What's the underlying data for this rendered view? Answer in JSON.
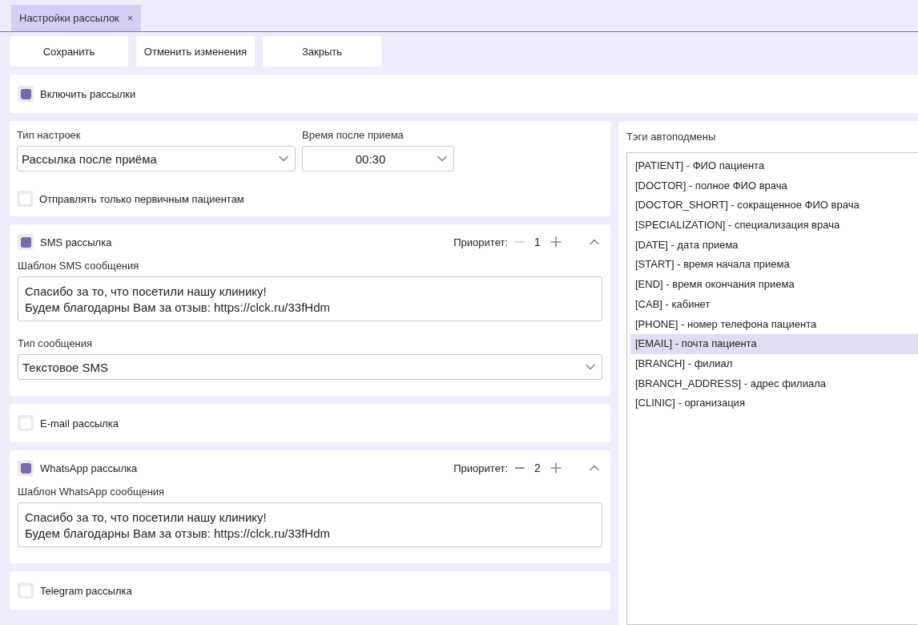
{
  "tabs": [
    {
      "label": "Настройки рассылок",
      "close": "×",
      "selected": true
    }
  ],
  "toolbar": {
    "buttons": [
      "Сохранить",
      "Отменить изменения",
      "Закрыть"
    ]
  },
  "enable_mailings": {
    "label": "Включить рассылки",
    "checked": true
  },
  "settings": {
    "type_label": "Тип настроек",
    "type_value": "Рассылка после приёма",
    "time_label": "Время после приема",
    "time_value": "00:30",
    "first_only": {
      "label": "Отправлять только первичным пациентам",
      "checked": false
    }
  },
  "channels": [
    {
      "label": "SMS рассылка",
      "checked": true,
      "priority_label": "Приоритет:",
      "priority": "1",
      "decrease_disabled": true,
      "expanded": true,
      "template_label": "Шаблон SMS сообщения",
      "template_lines": [
        "Спасибо за то, что посетили нашу клинику!",
        "Будем благодарны Вам за отзыв: https://clck.ru/33fHdm"
      ],
      "message_type_label": "Тип сообщения",
      "message_type": "Текстовое SMS"
    },
    {
      "label": "E-mail рассылка",
      "checked": false
    },
    {
      "label": "WhatsApp рассылка",
      "checked": true,
      "priority_label": "Приоритет:",
      "priority": "2",
      "decrease_disabled": false,
      "expanded": true,
      "template_label": "Шаблон WhatsApp сообщения",
      "template_lines": [
        "Спасибо за то, что посетили нашу клинику!",
        "Будем благодарны Вам за отзыв: https://clck.ru/33fHdm"
      ]
    },
    {
      "label": "Telegram рассылка",
      "checked": false
    }
  ],
  "tags": {
    "label": "Тэги автоподмены",
    "items": [
      {
        "text": "[PATIENT] - ФИО пациента",
        "selected": false
      },
      {
        "text": "[DOCTOR] - полное ФИО врача",
        "selected": false
      },
      {
        "text": "[DOCTOR_SHORT] - сокращенное ФИО врача",
        "selected": false
      },
      {
        "text": "[SPECIALIZATION] - специализация врача",
        "selected": false
      },
      {
        "text": "[DATE] - дата приема",
        "selected": false
      },
      {
        "text": "[START] - время начала приема",
        "selected": false
      },
      {
        "text": "[END] - время окончания приема",
        "selected": false
      },
      {
        "text": "[CAB] - кабинет",
        "selected": false
      },
      {
        "text": "[PHONE] - номер телефона пациента",
        "selected": false
      },
      {
        "text": "[EMAIL] - почта пациента",
        "selected": true
      },
      {
        "text": "[BRANCH] - филиал",
        "selected": false
      },
      {
        "text": "[BRANCH_ADDRESS] - адрес филиала",
        "selected": false
      },
      {
        "text": "[CLINIC] - организация",
        "selected": false
      }
    ]
  }
}
